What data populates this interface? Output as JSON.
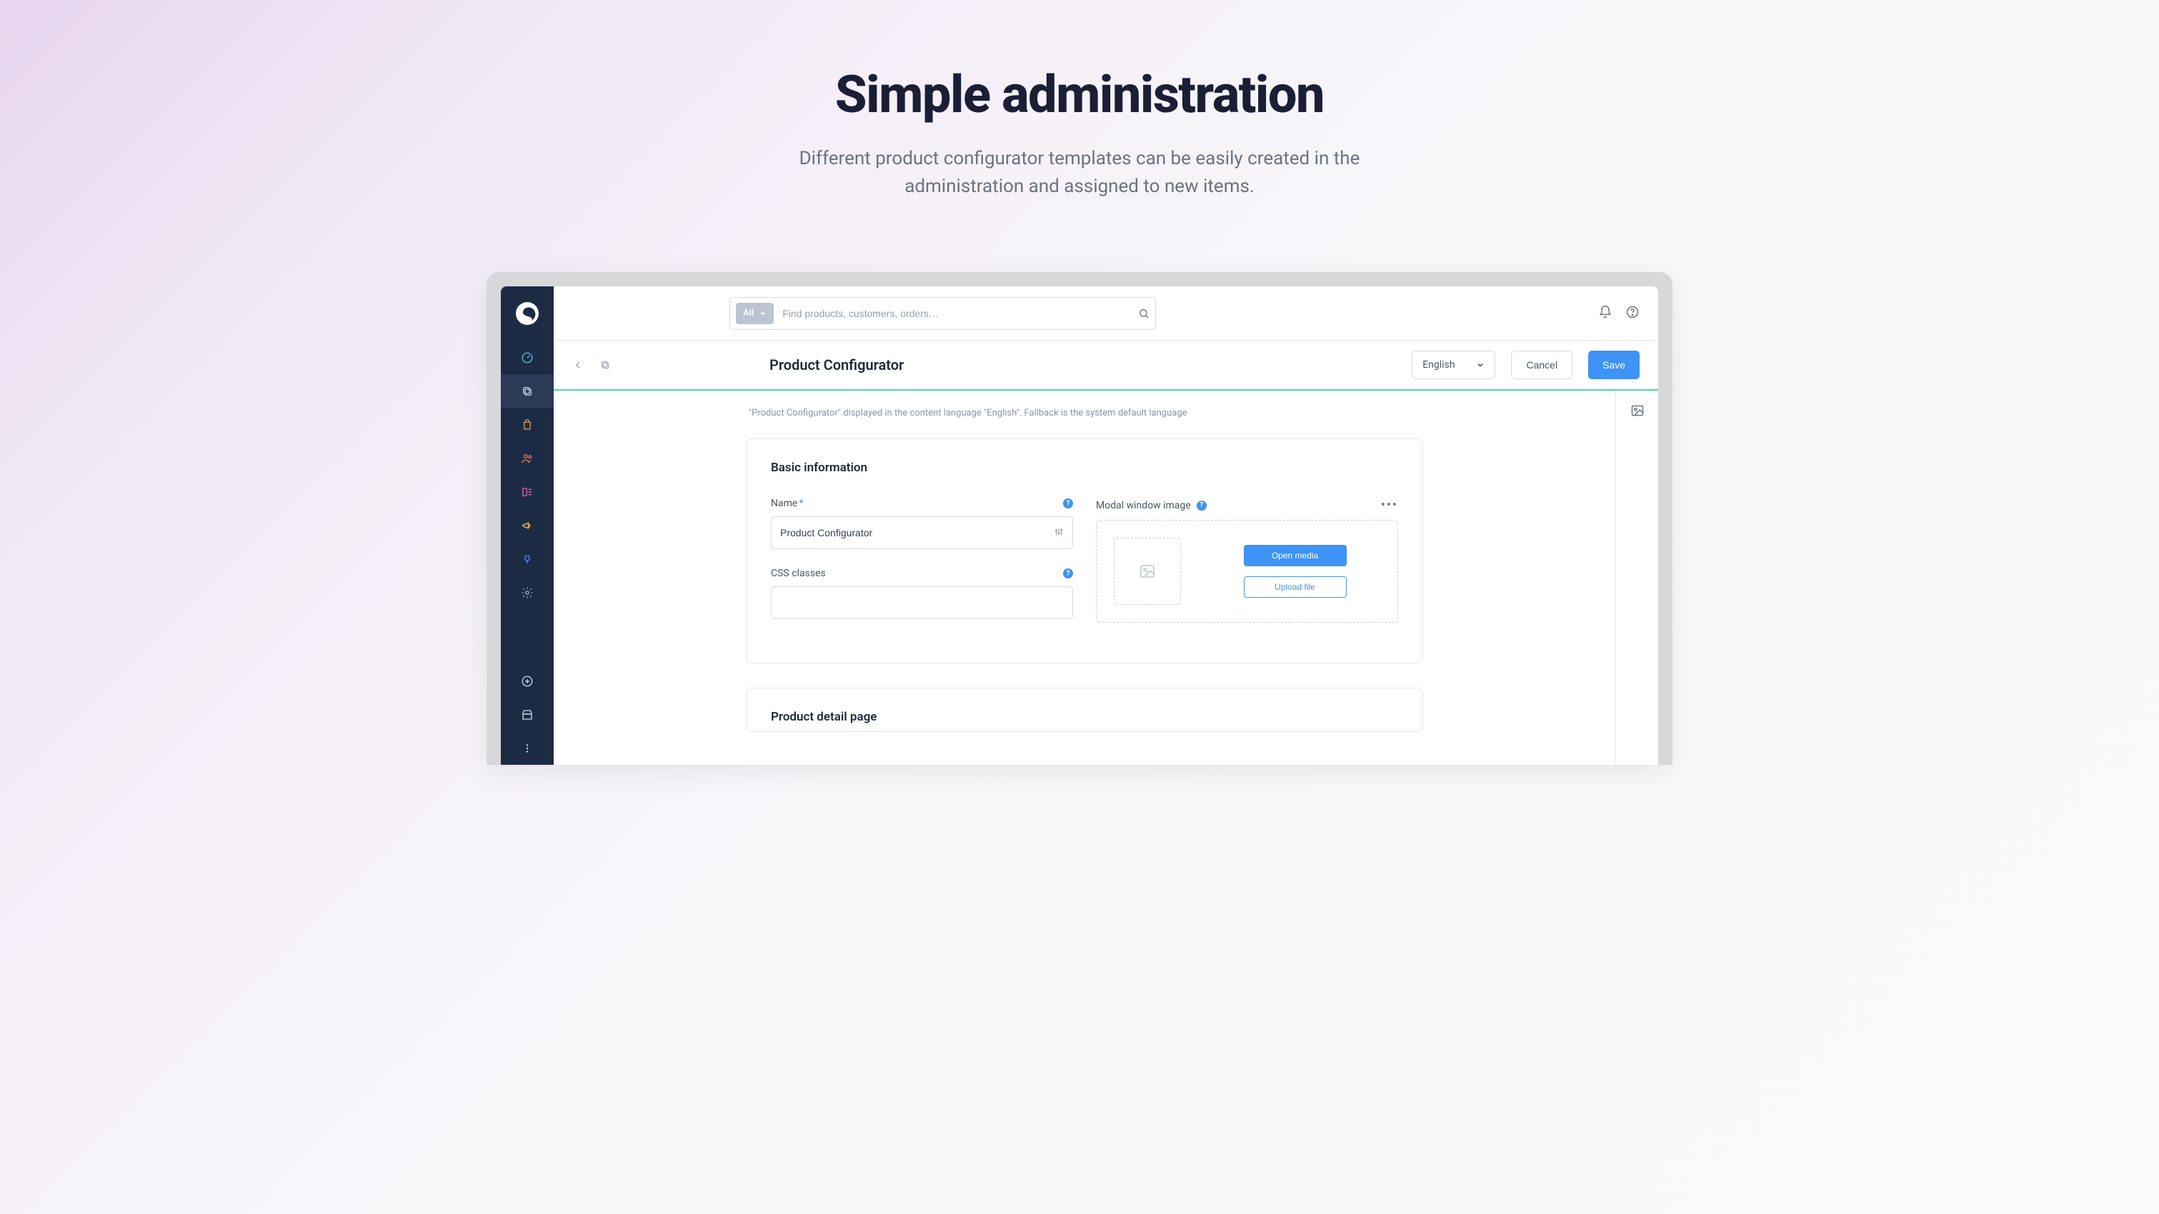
{
  "hero": {
    "title": "Simple administration",
    "subtitle": "Different product configurator templates can be easily created in the administration and assigned to new items."
  },
  "search": {
    "scope_label": "All",
    "placeholder": "Find products, customers, orders…"
  },
  "page_header": {
    "title": "Product Configurator",
    "language": "English",
    "cancel_label": "Cancel",
    "save_label": "Save"
  },
  "info_line": "\"Product Configurator\" displayed in the content language \"English\". Fallback is the system default language",
  "basic_card": {
    "title": "Basic information",
    "name_label": "Name",
    "name_value": "Product Configurator",
    "css_label": "CSS classes",
    "css_value": "",
    "modal_image_label": "Modal window image",
    "open_media_label": "Open media",
    "upload_file_label": "Upload file"
  },
  "detail_card": {
    "title": "Product detail page"
  }
}
